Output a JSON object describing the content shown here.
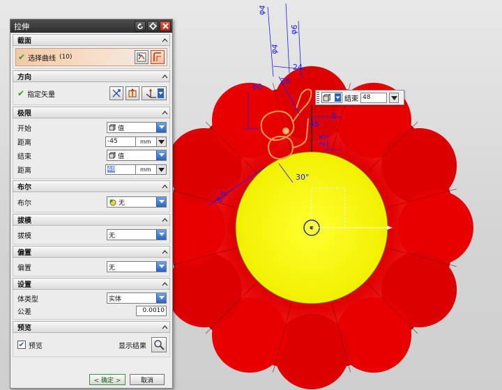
{
  "dialog": {
    "title": "拉伸",
    "sections": {
      "section": {
        "title": "截面",
        "select_curve": "选择曲线",
        "curve_count": "(10)"
      },
      "direction": {
        "title": "方向",
        "specify_vector": "指定矢量"
      },
      "limits": {
        "title": "极限",
        "start_label": "开始",
        "start_value": "值",
        "start_distance_label": "距离",
        "start_distance": "-45",
        "start_unit": "mm",
        "end_label": "结束",
        "end_value": "值",
        "end_distance_label": "距离",
        "end_distance": "48",
        "end_unit": "mm"
      },
      "boolean": {
        "title": "布尔",
        "label": "布尔",
        "value": "无"
      },
      "draft": {
        "title": "拔模",
        "label": "拔模",
        "value": "无"
      },
      "offset": {
        "title": "偏置",
        "label": "偏置",
        "value": "无"
      },
      "settings": {
        "title": "设置",
        "body_type_label": "体类型",
        "body_type_value": "实体",
        "tolerance_label": "公差",
        "tolerance_value": "0.0010"
      },
      "preview": {
        "title": "预览",
        "preview_label": "预览",
        "preview_checked": true,
        "show_result_label": "显示结果"
      }
    },
    "buttons": {
      "ok": "< 确定 >",
      "cancel": "取消"
    }
  },
  "graphics": {
    "float_input": {
      "label": "结束",
      "value": "48"
    },
    "dimensions": [
      "φ4",
      "φ6",
      "φ4",
      "60",
      "28",
      "24",
      "5",
      "30°",
      "8.5",
      "2.5",
      "45"
    ],
    "colors": {
      "petals": "#e40000",
      "center": "#ffff10",
      "dims": "#1a1aff",
      "highlight": "#f0a050"
    }
  }
}
